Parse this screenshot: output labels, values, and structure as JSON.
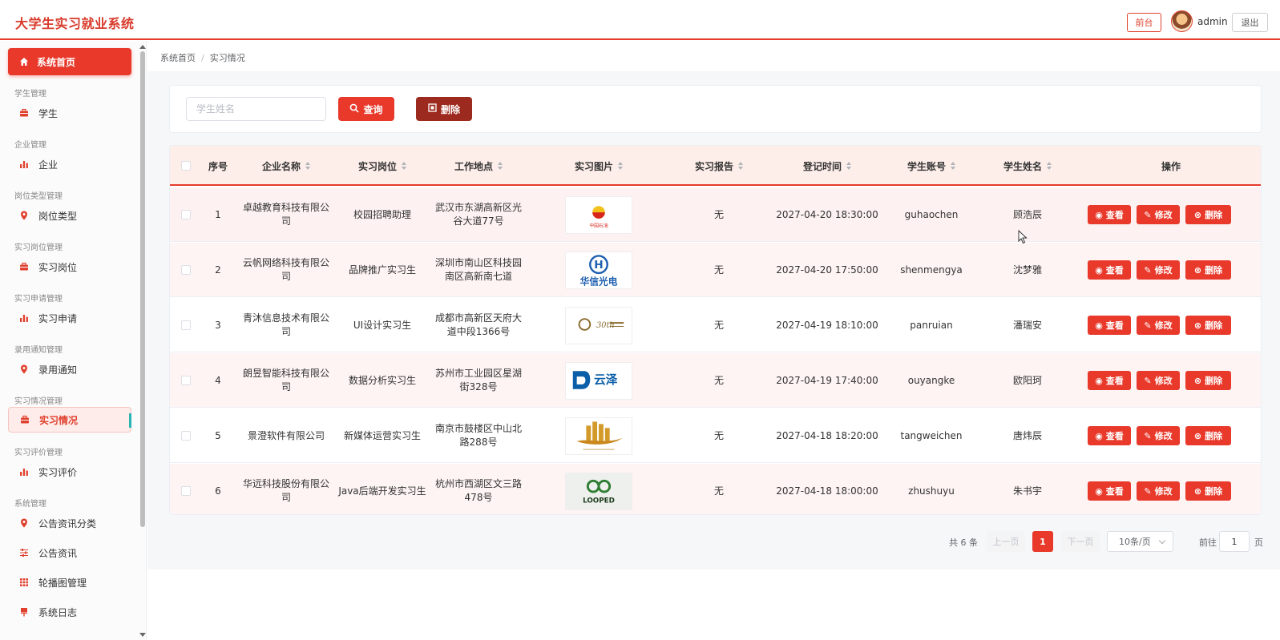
{
  "app": {
    "title": "大学生实习就业系统"
  },
  "header": {
    "front_label": "前台",
    "user_name": "admin",
    "logout_label": "退出"
  },
  "sidebar": {
    "home_label": "系统首页",
    "groups": [
      {
        "title": "学生管理",
        "item": "学生",
        "icon": "briefcase-icon"
      },
      {
        "title": "企业管理",
        "item": "企业",
        "icon": "bar-chart-icon"
      },
      {
        "title": "岗位类型管理",
        "item": "岗位类型",
        "icon": "location-pin-icon"
      },
      {
        "title": "实习岗位管理",
        "item": "实习岗位",
        "icon": "briefcase-icon"
      },
      {
        "title": "实习申请管理",
        "item": "实习申请",
        "icon": "bar-chart-icon"
      },
      {
        "title": "录用通知管理",
        "item": "录用通知",
        "icon": "location-pin-icon"
      },
      {
        "title": "实习情况管理",
        "item": "实习情况",
        "icon": "briefcase-icon"
      },
      {
        "title": "实习评价管理",
        "item": "实习评价",
        "icon": "bar-chart-icon"
      },
      {
        "title": "系统管理",
        "item": "公告资讯分类",
        "icon": "location-pin-icon"
      }
    ],
    "extra_items": [
      {
        "item": "公告资讯",
        "icon": "sliders-icon"
      },
      {
        "item": "轮播图管理",
        "icon": "grid-icon"
      },
      {
        "item": "系统日志",
        "icon": "flag-icon"
      }
    ]
  },
  "breadcrumb": {
    "home": "系统首页",
    "sep": "/",
    "current": "实习情况"
  },
  "search": {
    "placeholder": "学生姓名",
    "value": "",
    "query_label": "查询",
    "delete_label": "删除"
  },
  "table": {
    "headers": [
      "序号",
      "企业名称",
      "实习岗位",
      "工作地点",
      "实习图片",
      "实习报告",
      "登记时间",
      "学生账号",
      "学生姓名",
      "操作"
    ],
    "actions": {
      "view": "查看",
      "edit": "修改",
      "delete": "删除"
    },
    "rows": [
      {
        "no": "1",
        "company": "卓越教育科技有限公司",
        "position": "校园招聘助理",
        "location": "武汉市东湖高新区光谷大道77号",
        "image": "中国石油",
        "report": "无",
        "time": "2027-04-20 18:30:00",
        "account": "guhaochen",
        "name": "顾浩辰"
      },
      {
        "no": "2",
        "company": "云帆网络科技有限公司",
        "position": "品牌推广实习生",
        "location": "深圳市南山区科技园南区高新南七道",
        "image": "华信光电",
        "report": "无",
        "time": "2027-04-20 17:50:00",
        "account": "shenmengya",
        "name": "沈梦雅"
      },
      {
        "no": "3",
        "company": "青沐信息技术有限公司",
        "position": "UI设计实习生",
        "location": "成都市高新区天府大道中段1366号",
        "image": "30th",
        "report": "无",
        "time": "2027-04-19 18:10:00",
        "account": "panruian",
        "name": "潘瑞安"
      },
      {
        "no": "4",
        "company": "朗昱智能科技有限公司",
        "position": "数据分析实习生",
        "location": "苏州市工业园区星湖街328号",
        "image": "云泽",
        "report": "无",
        "time": "2027-04-19 17:40:00",
        "account": "ouyangke",
        "name": "欧阳珂"
      },
      {
        "no": "5",
        "company": "景澄软件有限公司",
        "position": "新媒体运营实习生",
        "location": "南京市鼓楼区中山北路288号",
        "image": "",
        "report": "无",
        "time": "2027-04-18 18:20:00",
        "account": "tangweichen",
        "name": "唐炜辰"
      },
      {
        "no": "6",
        "company": "华远科技股份有限公司",
        "position": "Java后端开发实习生",
        "location": "杭州市西湖区文三路478号",
        "image": "LOOPED",
        "report": "无",
        "time": "2027-04-18 18:00:00",
        "account": "zhushuyu",
        "name": "朱书宇"
      }
    ]
  },
  "pagination": {
    "total": "共 6 条",
    "prev": "上一页",
    "page": "1",
    "next": "下一页",
    "page_size": "10条/页",
    "goto": "前往",
    "goto_value": "1",
    "page_unit": "页"
  },
  "colors": {
    "accent": "#e8392b",
    "dark_red": "#9d2a1e",
    "header_bg": "#fdeeea"
  }
}
